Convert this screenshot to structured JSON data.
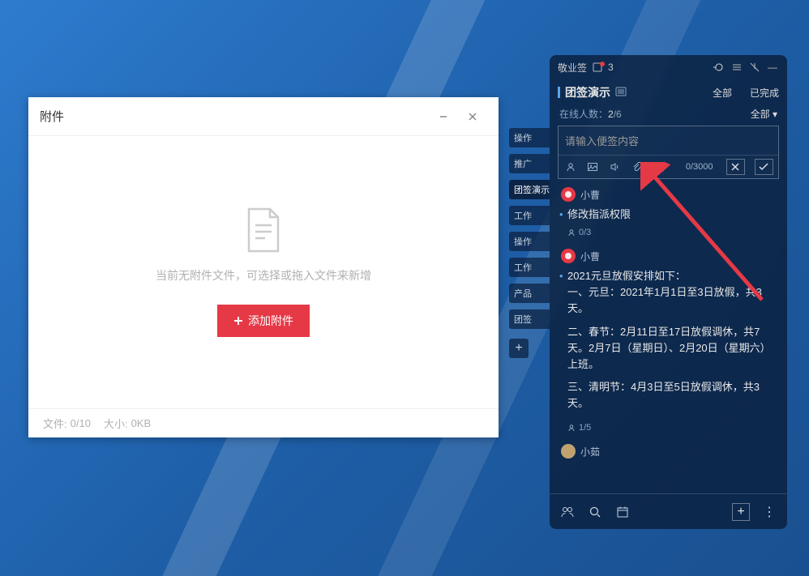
{
  "attachWindow": {
    "title": "附件",
    "emptyText": "当前无附件文件，可选择或拖入文件来新增",
    "addButton": "添加附件",
    "footer": {
      "fileLabel": "文件:",
      "fileCount": "0/10",
      "sizeLabel": "大小:",
      "size": "0KB"
    }
  },
  "notesPanel": {
    "appName": "敬业签",
    "notifCount": "3",
    "tabName": "团签演示",
    "filterAll": "全部",
    "filterDone": "已完成",
    "onlineLabel": "在线人数：",
    "onlineCount": "2",
    "onlineTotal": "/6",
    "composer": {
      "placeholder": "请输入便签内容",
      "counter": "0/3000"
    },
    "users": {
      "u1": "小曹",
      "u2": "小曹",
      "u3": "小茹"
    },
    "notes": {
      "n1": {
        "text": "修改指派权限",
        "meta": "0/3"
      },
      "n2": {
        "p1": "2021元旦放假安排如下：",
        "p2": "一、元旦：2021年1月1日至3日放假，共3天。",
        "p3": "二、春节：2月11日至17日放假调休，共7天。2月7日（星期日）、2月20日（星期六）上班。",
        "p4": "三、清明节：4月3日至5日放假调休，共3天。",
        "meta": "1/5"
      }
    }
  },
  "sideTabs": {
    "t1": "操作",
    "t2": "推广",
    "t3": "团签演示",
    "t4": "工作",
    "t5": "操作",
    "t6": "工作",
    "t7": "产品",
    "t8": "团签"
  }
}
